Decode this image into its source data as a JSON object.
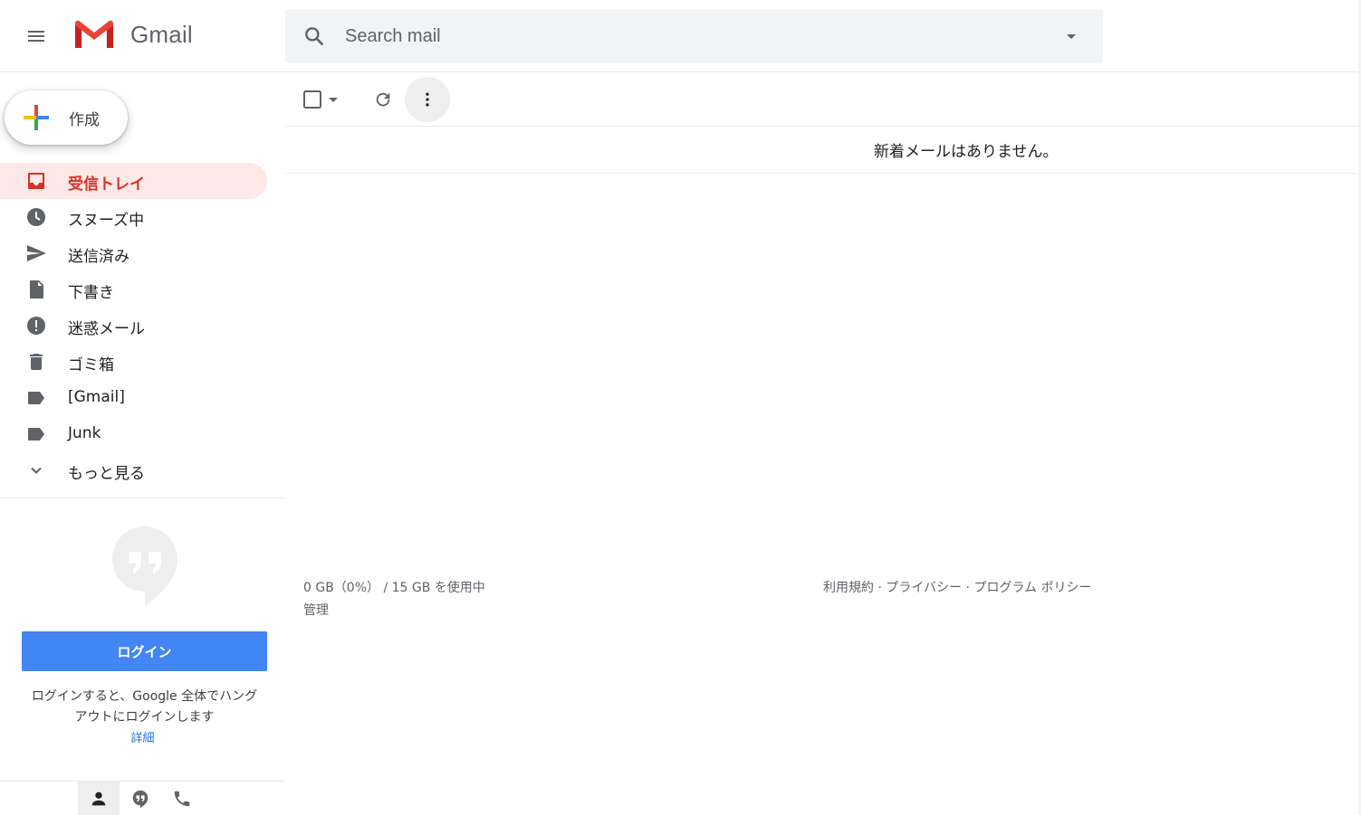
{
  "app": {
    "logo_text": "Gmail"
  },
  "search": {
    "placeholder": "Search mail"
  },
  "compose": {
    "label": "作成"
  },
  "nav": {
    "items": [
      {
        "label": "受信トレイ",
        "icon": "inbox-icon",
        "active": true
      },
      {
        "label": "スヌーズ中",
        "icon": "clock-icon"
      },
      {
        "label": "送信済み",
        "icon": "send-icon"
      },
      {
        "label": "下書き",
        "icon": "draft-file-icon"
      },
      {
        "label": "迷惑メール",
        "icon": "spam-alert-icon"
      },
      {
        "label": "ゴミ箱",
        "icon": "trash-icon"
      },
      {
        "label": "[Gmail]",
        "icon": "label-icon"
      },
      {
        "label": "Junk",
        "icon": "label-icon"
      },
      {
        "label": "もっと見る",
        "icon": "chevron-down-icon"
      }
    ]
  },
  "hangouts": {
    "login_label": "ログイン",
    "description_line1": "ログインすると、Google 全体でハング",
    "description_line2": "アウトにログインします",
    "learn_more": "詳細"
  },
  "main": {
    "empty_message": "新着メールはありません。"
  },
  "footer": {
    "storage": "0 GB（0%） / 15 GB を使用中",
    "manage": "管理",
    "terms": "利用規約",
    "privacy": "プライバシー",
    "program_policies": "プログラム ポリシー",
    "separator": " · "
  },
  "colors": {
    "accent_red": "#d93025",
    "active_bg": "#fce8e6",
    "login_blue": "#4285f4",
    "link_blue": "#1a73e8",
    "icon_gray": "#5f6368"
  }
}
